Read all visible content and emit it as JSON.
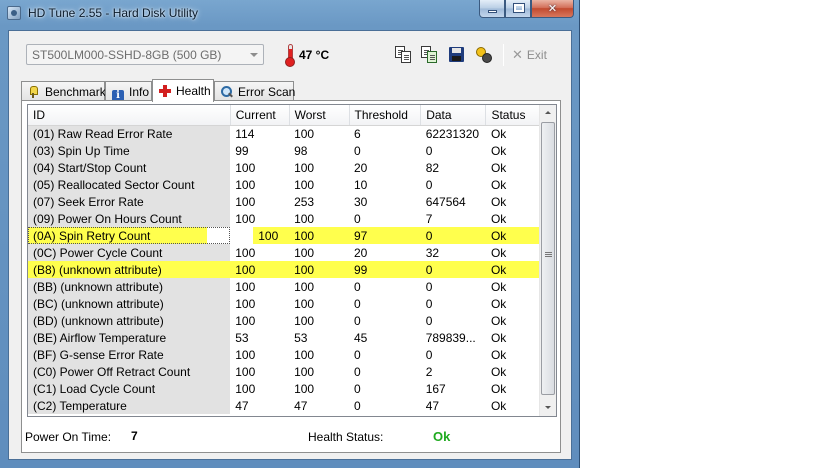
{
  "window": {
    "title": "HD Tune 2.55 - Hard Disk Utility",
    "controls": {
      "minimize": "",
      "maximize": "",
      "close": "✕"
    }
  },
  "toolbar": {
    "drive": "ST500LM000-SSHD-8GB (500 GB)",
    "temperature": "47 °C",
    "exit_label": "Exit",
    "icons": [
      "copy-text-icon",
      "copy-screenshot-icon",
      "save-icon",
      "options-icon",
      "exit-icon"
    ]
  },
  "tabs": [
    {
      "label": "Benchmark",
      "icon": "lightbulb-icon"
    },
    {
      "label": "Info",
      "icon": "info-icon"
    },
    {
      "label": "Health",
      "icon": "health-cross-icon",
      "active": true
    },
    {
      "label": "Error Scan",
      "icon": "magnifier-icon"
    }
  ],
  "table": {
    "columns": [
      "ID",
      "Current",
      "Worst",
      "Threshold",
      "Data",
      "Status"
    ],
    "rows": [
      [
        "(01) Raw Read Error Rate",
        "114",
        "100",
        "6",
        "62231320",
        "Ok"
      ],
      [
        "(03) Spin Up Time",
        "99",
        "98",
        "0",
        "0",
        "Ok"
      ],
      [
        "(04) Start/Stop Count",
        "100",
        "100",
        "20",
        "82",
        "Ok"
      ],
      [
        "(05) Reallocated Sector Count",
        "100",
        "100",
        "10",
        "0",
        "Ok"
      ],
      [
        "(07) Seek Error Rate",
        "100",
        "253",
        "30",
        "647564",
        "Ok"
      ],
      [
        "(09) Power On Hours Count",
        "100",
        "100",
        "0",
        "7",
        "Ok"
      ],
      [
        "(0A) Spin Retry Count",
        "100",
        "100",
        "97",
        "0",
        "Ok"
      ],
      [
        "(0C) Power Cycle Count",
        "100",
        "100",
        "20",
        "32",
        "Ok"
      ],
      [
        "(B8) (unknown attribute)",
        "100",
        "100",
        "99",
        "0",
        "Ok"
      ],
      [
        "(BB) (unknown attribute)",
        "100",
        "100",
        "0",
        "0",
        "Ok"
      ],
      [
        "(BC) (unknown attribute)",
        "100",
        "100",
        "0",
        "0",
        "Ok"
      ],
      [
        "(BD) (unknown attribute)",
        "100",
        "100",
        "0",
        "0",
        "Ok"
      ],
      [
        "(BE) Airflow Temperature",
        "53",
        "53",
        "45",
        "789839...",
        "Ok"
      ],
      [
        "(BF) G-sense Error Rate",
        "100",
        "100",
        "0",
        "0",
        "Ok"
      ],
      [
        "(C0) Power Off Retract Count",
        "100",
        "100",
        "0",
        "2",
        "Ok"
      ],
      [
        "(C1) Load Cycle Count",
        "100",
        "100",
        "0",
        "167",
        "Ok"
      ],
      [
        "(C2) Temperature",
        "47",
        "47",
        "0",
        "47",
        "Ok"
      ]
    ],
    "highlighted_rows": [
      6,
      8
    ],
    "highlight_color": "#ffff4d"
  },
  "status": {
    "power_on_label": "Power On Time:",
    "power_on_value": "7",
    "health_label": "Health Status:",
    "health_value": "Ok",
    "health_color": "#1faa1f"
  }
}
